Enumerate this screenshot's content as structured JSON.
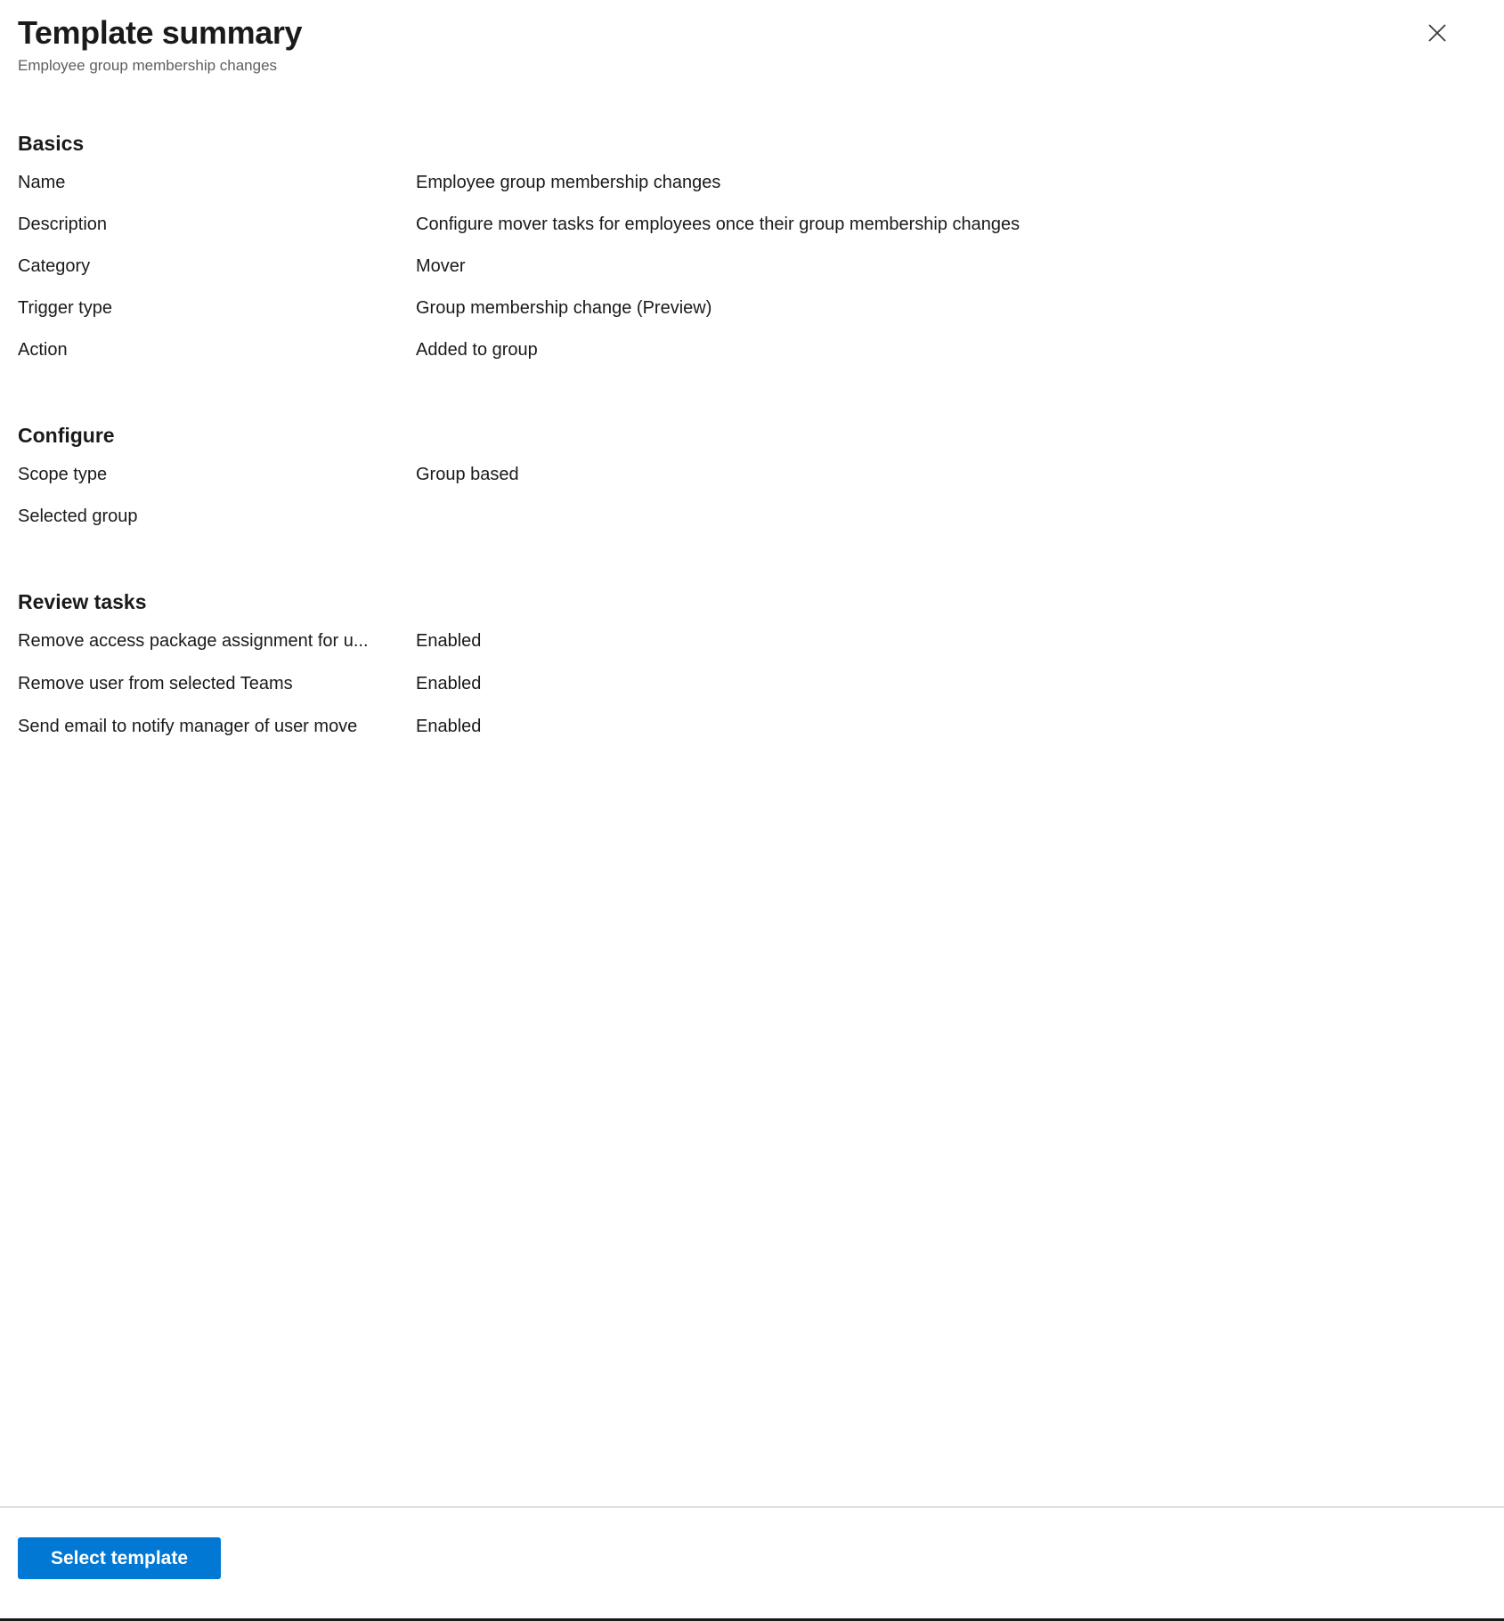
{
  "header": {
    "title": "Template summary",
    "subtitle": "Employee group membership changes",
    "close_icon": "close-icon"
  },
  "sections": [
    {
      "id": "basics",
      "title": "Basics",
      "rows": [
        {
          "label": "Name",
          "value": "Employee group membership changes"
        },
        {
          "label": "Description",
          "value": "Configure mover tasks for employees once their group membership changes"
        },
        {
          "label": "Category",
          "value": "Mover"
        },
        {
          "label": "Trigger type",
          "value": "Group membership change (Preview)"
        },
        {
          "label": "Action",
          "value": "Added to group"
        }
      ]
    },
    {
      "id": "configure",
      "title": "Configure",
      "rows": [
        {
          "label": "Scope type",
          "value": "Group based"
        },
        {
          "label": "Selected group",
          "value": ""
        }
      ]
    },
    {
      "id": "review-tasks",
      "title": "Review tasks",
      "rows": [
        {
          "label": "Remove access package assignment for u...",
          "value": "Enabled"
        },
        {
          "label": "Remove user from selected Teams",
          "value": "Enabled"
        },
        {
          "label": "Send email to notify manager of user move",
          "value": "Enabled"
        }
      ]
    }
  ],
  "footer": {
    "primary_button_label": "Select template"
  },
  "colors": {
    "accent": "#0078d4",
    "text": "#1b1a19",
    "muted_text": "#605e5c",
    "divider": "#e1dfdd",
    "background": "#ffffff"
  }
}
